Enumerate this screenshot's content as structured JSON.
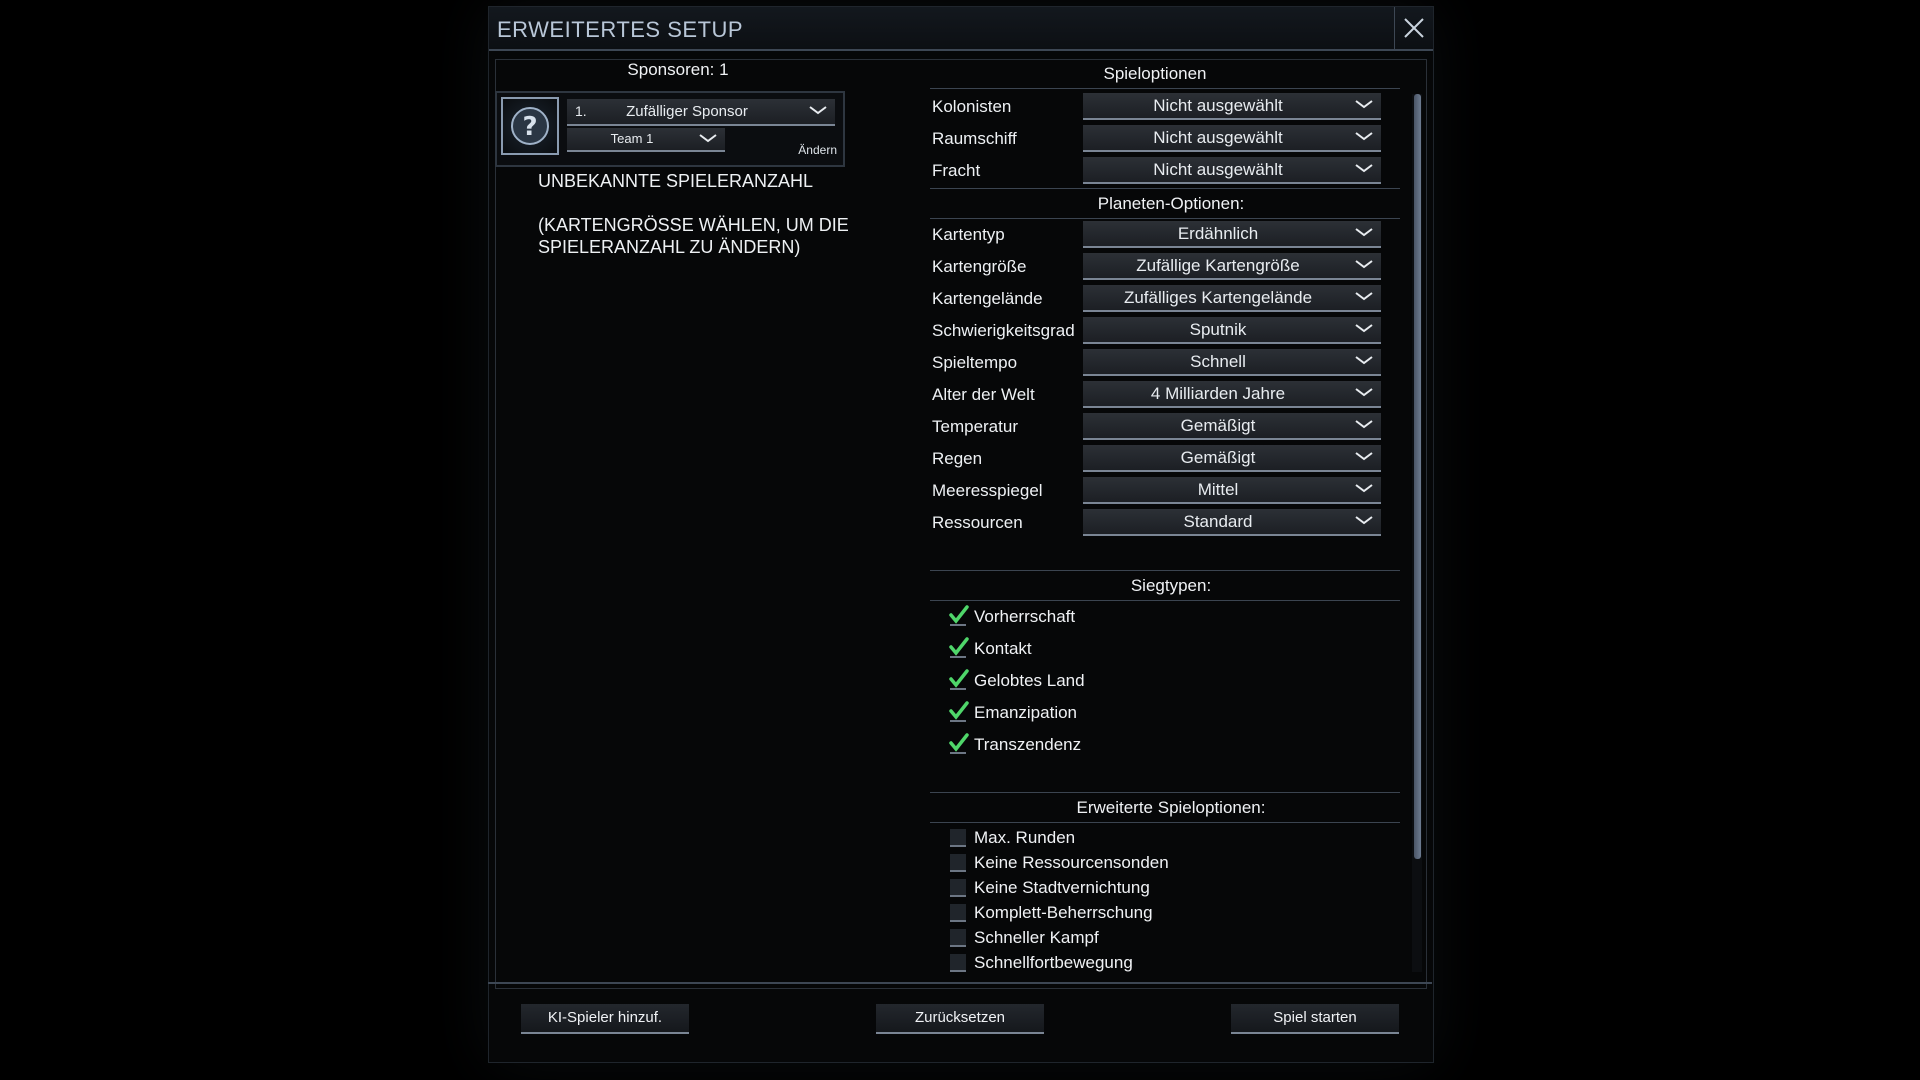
{
  "window": {
    "title": "ERWEITERTES SETUP"
  },
  "sponsors": {
    "header": "Sponsoren: 1",
    "player": {
      "number": "1.",
      "sponsor": "Zufälliger Sponsor",
      "team": "Team 1",
      "change_label": "Ändern",
      "avatar_icon": "question-mark-icon"
    },
    "unknown_count": "UNBEKANNTE SPIELERANZAHL",
    "hint": "(KARTENGRÖSSE WÄHLEN, UM DIE SPIELERANZAHL ZU ÄNDERN)"
  },
  "game_options": {
    "header": "Spieloptionen",
    "items": [
      {
        "label": "Kolonisten",
        "value": "Nicht ausgewählt"
      },
      {
        "label": "Raumschiff",
        "value": "Nicht ausgewählt"
      },
      {
        "label": "Fracht",
        "value": "Nicht ausgewählt"
      }
    ]
  },
  "planet_options": {
    "header": "Planeten-Optionen:",
    "items": [
      {
        "label": "Kartentyp",
        "value": "Erdähnlich"
      },
      {
        "label": "Kartengröße",
        "value": "Zufällige Kartengröße"
      },
      {
        "label": "Kartengelände",
        "value": "Zufälliges Kartengelände"
      },
      {
        "label": "Schwierigkeitsgrad",
        "value": "Sputnik"
      },
      {
        "label": "Spieltempo",
        "value": "Schnell"
      },
      {
        "label": "Alter der Welt",
        "value": "4 Milliarden Jahre"
      },
      {
        "label": "Temperatur",
        "value": "Gemäßigt"
      },
      {
        "label": "Regen",
        "value": "Gemäßigt"
      },
      {
        "label": "Meeresspiegel",
        "value": "Mittel"
      },
      {
        "label": "Ressourcen",
        "value": "Standard"
      }
    ]
  },
  "victory": {
    "header": "Siegtypen:",
    "items": [
      {
        "label": "Vorherrschaft",
        "checked": true
      },
      {
        "label": "Kontakt",
        "checked": true
      },
      {
        "label": "Gelobtes Land",
        "checked": true
      },
      {
        "label": "Emanzipation",
        "checked": true
      },
      {
        "label": "Transzendenz",
        "checked": true
      }
    ]
  },
  "advanced": {
    "header": "Erweiterte Spieloptionen:",
    "items": [
      {
        "label": "Max. Runden",
        "checked": false
      },
      {
        "label": "Keine Ressourcensonden",
        "checked": false
      },
      {
        "label": "Keine Stadtvernichtung",
        "checked": false
      },
      {
        "label": "Komplett-Beherrschung",
        "checked": false
      },
      {
        "label": "Schneller Kampf",
        "checked": false
      },
      {
        "label": "Schnellfortbewegung",
        "checked": false
      }
    ]
  },
  "footer": {
    "add_ai": "KI-Spieler hinzuf.",
    "reset": "Zurücksetzen",
    "start": "Spiel starten"
  },
  "colors": {
    "accent_check": "#4fd66a",
    "title_text": "#b9c7d8",
    "divider": "#3d4754"
  }
}
